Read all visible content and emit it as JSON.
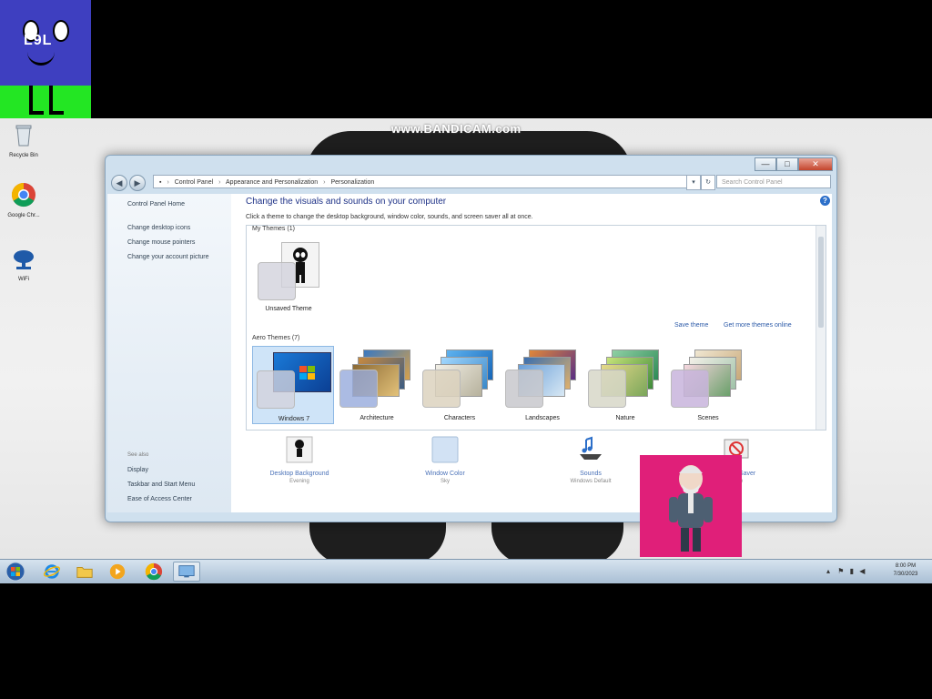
{
  "overlay": {
    "mascot_tag": "L9L",
    "watermark": "www.BANDICAM.com"
  },
  "desktop_icons": [
    {
      "label": "Recycle Bin",
      "icon": "recycle-bin-icon"
    },
    {
      "label": "Google Chr...",
      "icon": "chrome-icon"
    },
    {
      "label": "WiFi",
      "icon": "network-icon"
    }
  ],
  "window": {
    "controls": {
      "minimize": "—",
      "maximize": "□",
      "close": "✕"
    },
    "breadcrumb": [
      "Control Panel",
      "Appearance and Personalization",
      "Personalization"
    ],
    "search_placeholder": "Search Control Panel",
    "sidebar": {
      "home": "Control Panel Home",
      "links": [
        "Change desktop icons",
        "Change mouse pointers",
        "Change your account picture"
      ],
      "see_also_header": "See also",
      "see_also": [
        "Display",
        "Taskbar and Start Menu",
        "Ease of Access Center"
      ]
    },
    "heading": "Change the visuals and sounds on your computer",
    "subheading": "Click a theme to change the desktop background, window color, sounds, and screen saver all at once.",
    "my_themes_header": "My Themes (1)",
    "unsaved_theme": "Unsaved Theme",
    "save_theme": "Save theme",
    "get_more_themes": "Get more themes online",
    "aero_themes_header": "Aero Themes (7)",
    "aero_themes": [
      "Windows 7",
      "Architecture",
      "Characters",
      "Landscapes",
      "Nature",
      "Scenes"
    ],
    "bottom": [
      {
        "title": "Desktop Background",
        "sub": "Evening"
      },
      {
        "title": "Window Color",
        "sub": "Sky"
      },
      {
        "title": "Sounds",
        "sub": "Windows Default"
      },
      {
        "title": "Screen Saver",
        "sub": "None"
      }
    ]
  },
  "taskbar": {
    "time": "8:00 PM",
    "date": "7/30/2023"
  },
  "colors": {
    "heading": "#1e3287",
    "link": "#2c5aa8",
    "selection": "#cfe4f8",
    "cam_background": "#e01f79",
    "mascot_face": "#3e3fc0",
    "mascot_legs": "#23e623"
  }
}
